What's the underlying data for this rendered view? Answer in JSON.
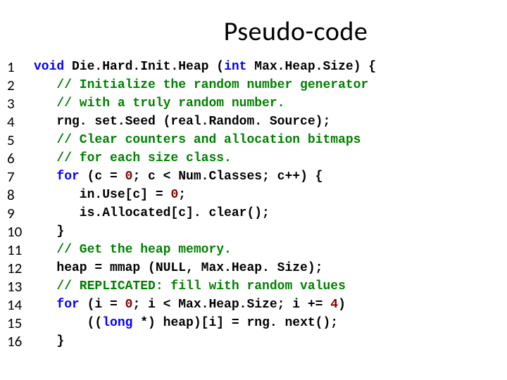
{
  "title": "Pseudo-code",
  "line_numbers": [
    "1",
    "2",
    "3",
    "4",
    "5",
    "6",
    "7",
    "8",
    "9",
    "10",
    "11",
    "12",
    "13",
    "14",
    "15",
    "16"
  ],
  "code": {
    "l1": {
      "kw1": "void",
      "t1": " Die.Hard.Init.Heap (",
      "kw2": "int",
      "t2": " Max.Heap.Size) {"
    },
    "l2": {
      "cm": "   // Initialize the random number generator"
    },
    "l3": {
      "cm": "   // with a truly random number."
    },
    "l4": {
      "t": "   rng. set.Seed (real.Random. Source);"
    },
    "l5": {
      "cm": "   // Clear counters and allocation bitmaps"
    },
    "l6": {
      "cm": "   // for each size class."
    },
    "l7": {
      "ind": "   ",
      "kw": "for",
      "t1": " (c = ",
      "n1": "0",
      "t2": "; c < Num.Classes; c++) {"
    },
    "l8": {
      "t1": "      in.Use[c] = ",
      "n": "0",
      "t2": ";"
    },
    "l9": {
      "t": "      is.Allocated[c]. clear();"
    },
    "l10": {
      "t": "   }"
    },
    "l11": {
      "cm": "   // Get the heap memory."
    },
    "l12": {
      "t": "   heap = mmap (NULL, Max.Heap. Size);"
    },
    "l13": {
      "cm": "   // REPLICATED: fill with random values"
    },
    "l14": {
      "ind": "   ",
      "kw": "for",
      "t1": " (i = ",
      "n1": "0",
      "t2": "; i < Max.Heap.Size; i += ",
      "n2": "4",
      "t3": ")"
    },
    "l15": {
      "t1": "       ((",
      "kw": "long",
      "t2": " *) heap)[i] = rng. next();"
    },
    "l16": {
      "t": "   }"
    }
  }
}
